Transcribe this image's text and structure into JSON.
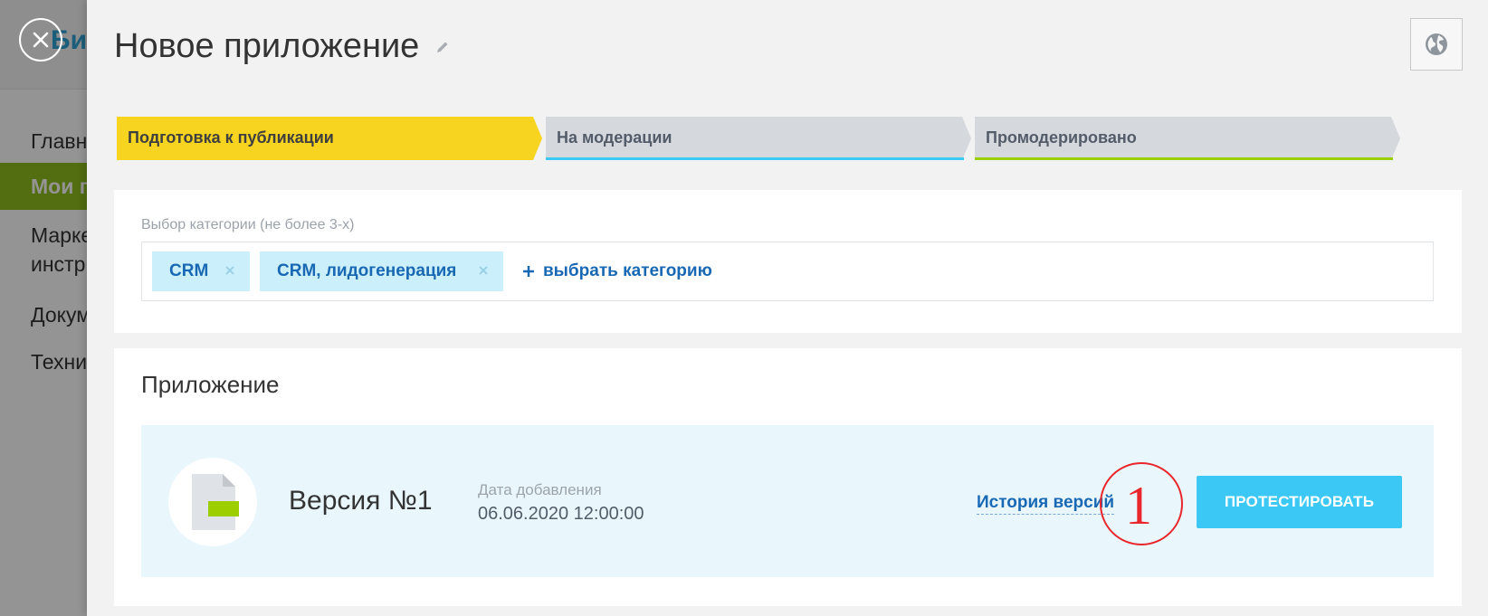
{
  "background": {
    "logo_text": "Бит",
    "nav_items": [
      "Главн",
      "Мои п",
      "Марке",
      "инстр",
      "Докум",
      "Техни"
    ]
  },
  "header": {
    "title": "Новое приложение"
  },
  "stages": [
    {
      "label": "Подготовка к публикации",
      "active": true,
      "color": "#f7d41f"
    },
    {
      "label": "На модерации",
      "active": false,
      "color": "#d5d8dd",
      "accent": "#3bc8f5"
    },
    {
      "label": "Промодерировано",
      "active": false,
      "color": "#d5d8dd",
      "accent": "#9dcf00"
    }
  ],
  "categories": {
    "label": "Выбор категории (не более 3-х)",
    "tags": [
      {
        "text": "CRM"
      },
      {
        "text": "CRM, лидогенерация"
      }
    ],
    "add_label": "выбрать категорию"
  },
  "app": {
    "section_title": "Приложение",
    "version_name": "Версия №1",
    "date_label": "Дата добавления",
    "date_value": "06.06.2020 12:00:00",
    "history_link": "История версий",
    "callout_number": "1",
    "test_button": "ПРОТЕСТИРОВАТЬ"
  },
  "colors": {
    "accent_blue": "#3bc8f5",
    "link_blue": "#1868b4",
    "stage_yellow": "#f7d41f",
    "stage_green": "#9dcf00",
    "callout_red": "#e8262b"
  },
  "icons": [
    "close-icon",
    "pencil-icon",
    "globe-icon",
    "remove-tag-icon",
    "plus-icon",
    "file-icon"
  ]
}
